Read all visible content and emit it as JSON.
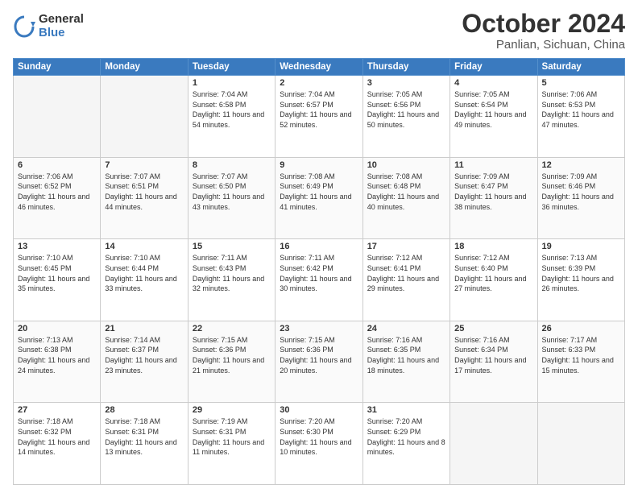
{
  "logo": {
    "general": "General",
    "blue": "Blue"
  },
  "title": "October 2024",
  "location": "Panlian, Sichuan, China",
  "weekdays": [
    "Sunday",
    "Monday",
    "Tuesday",
    "Wednesday",
    "Thursday",
    "Friday",
    "Saturday"
  ],
  "weeks": [
    [
      {
        "day": "",
        "detail": ""
      },
      {
        "day": "",
        "detail": ""
      },
      {
        "day": "1",
        "detail": "Sunrise: 7:04 AM\nSunset: 6:58 PM\nDaylight: 11 hours and 54 minutes."
      },
      {
        "day": "2",
        "detail": "Sunrise: 7:04 AM\nSunset: 6:57 PM\nDaylight: 11 hours and 52 minutes."
      },
      {
        "day": "3",
        "detail": "Sunrise: 7:05 AM\nSunset: 6:56 PM\nDaylight: 11 hours and 50 minutes."
      },
      {
        "day": "4",
        "detail": "Sunrise: 7:05 AM\nSunset: 6:54 PM\nDaylight: 11 hours and 49 minutes."
      },
      {
        "day": "5",
        "detail": "Sunrise: 7:06 AM\nSunset: 6:53 PM\nDaylight: 11 hours and 47 minutes."
      }
    ],
    [
      {
        "day": "6",
        "detail": "Sunrise: 7:06 AM\nSunset: 6:52 PM\nDaylight: 11 hours and 46 minutes."
      },
      {
        "day": "7",
        "detail": "Sunrise: 7:07 AM\nSunset: 6:51 PM\nDaylight: 11 hours and 44 minutes."
      },
      {
        "day": "8",
        "detail": "Sunrise: 7:07 AM\nSunset: 6:50 PM\nDaylight: 11 hours and 43 minutes."
      },
      {
        "day": "9",
        "detail": "Sunrise: 7:08 AM\nSunset: 6:49 PM\nDaylight: 11 hours and 41 minutes."
      },
      {
        "day": "10",
        "detail": "Sunrise: 7:08 AM\nSunset: 6:48 PM\nDaylight: 11 hours and 40 minutes."
      },
      {
        "day": "11",
        "detail": "Sunrise: 7:09 AM\nSunset: 6:47 PM\nDaylight: 11 hours and 38 minutes."
      },
      {
        "day": "12",
        "detail": "Sunrise: 7:09 AM\nSunset: 6:46 PM\nDaylight: 11 hours and 36 minutes."
      }
    ],
    [
      {
        "day": "13",
        "detail": "Sunrise: 7:10 AM\nSunset: 6:45 PM\nDaylight: 11 hours and 35 minutes."
      },
      {
        "day": "14",
        "detail": "Sunrise: 7:10 AM\nSunset: 6:44 PM\nDaylight: 11 hours and 33 minutes."
      },
      {
        "day": "15",
        "detail": "Sunrise: 7:11 AM\nSunset: 6:43 PM\nDaylight: 11 hours and 32 minutes."
      },
      {
        "day": "16",
        "detail": "Sunrise: 7:11 AM\nSunset: 6:42 PM\nDaylight: 11 hours and 30 minutes."
      },
      {
        "day": "17",
        "detail": "Sunrise: 7:12 AM\nSunset: 6:41 PM\nDaylight: 11 hours and 29 minutes."
      },
      {
        "day": "18",
        "detail": "Sunrise: 7:12 AM\nSunset: 6:40 PM\nDaylight: 11 hours and 27 minutes."
      },
      {
        "day": "19",
        "detail": "Sunrise: 7:13 AM\nSunset: 6:39 PM\nDaylight: 11 hours and 26 minutes."
      }
    ],
    [
      {
        "day": "20",
        "detail": "Sunrise: 7:13 AM\nSunset: 6:38 PM\nDaylight: 11 hours and 24 minutes."
      },
      {
        "day": "21",
        "detail": "Sunrise: 7:14 AM\nSunset: 6:37 PM\nDaylight: 11 hours and 23 minutes."
      },
      {
        "day": "22",
        "detail": "Sunrise: 7:15 AM\nSunset: 6:36 PM\nDaylight: 11 hours and 21 minutes."
      },
      {
        "day": "23",
        "detail": "Sunrise: 7:15 AM\nSunset: 6:36 PM\nDaylight: 11 hours and 20 minutes."
      },
      {
        "day": "24",
        "detail": "Sunrise: 7:16 AM\nSunset: 6:35 PM\nDaylight: 11 hours and 18 minutes."
      },
      {
        "day": "25",
        "detail": "Sunrise: 7:16 AM\nSunset: 6:34 PM\nDaylight: 11 hours and 17 minutes."
      },
      {
        "day": "26",
        "detail": "Sunrise: 7:17 AM\nSunset: 6:33 PM\nDaylight: 11 hours and 15 minutes."
      }
    ],
    [
      {
        "day": "27",
        "detail": "Sunrise: 7:18 AM\nSunset: 6:32 PM\nDaylight: 11 hours and 14 minutes."
      },
      {
        "day": "28",
        "detail": "Sunrise: 7:18 AM\nSunset: 6:31 PM\nDaylight: 11 hours and 13 minutes."
      },
      {
        "day": "29",
        "detail": "Sunrise: 7:19 AM\nSunset: 6:31 PM\nDaylight: 11 hours and 11 minutes."
      },
      {
        "day": "30",
        "detail": "Sunrise: 7:20 AM\nSunset: 6:30 PM\nDaylight: 11 hours and 10 minutes."
      },
      {
        "day": "31",
        "detail": "Sunrise: 7:20 AM\nSunset: 6:29 PM\nDaylight: 11 hours and 8 minutes."
      },
      {
        "day": "",
        "detail": ""
      },
      {
        "day": "",
        "detail": ""
      }
    ]
  ]
}
